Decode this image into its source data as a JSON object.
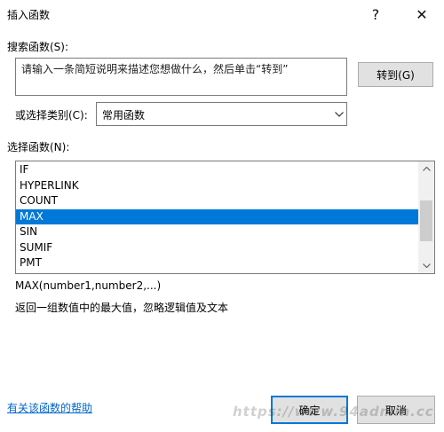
{
  "window": {
    "title": "插入函数",
    "help_glyph": "?",
    "close_glyph": "✕"
  },
  "search": {
    "label": "搜索函数(S):",
    "value": "请输入一条简短说明来描述您想做什么，然后单击“转到”",
    "goto_label": "转到(G)"
  },
  "category": {
    "label": "或选择类别(C):",
    "selected": "常用函数",
    "arrow_icon": "chevron-down-icon"
  },
  "functions": {
    "label": "选择函数(N):",
    "items": [
      "IF",
      "HYPERLINK",
      "COUNT",
      "MAX",
      "SIN",
      "SUMIF",
      "PMT"
    ],
    "selected_index": 3,
    "selected_color": "#0078d7"
  },
  "signature": "MAX(number1,number2,...)",
  "description": "返回一组数值中的最大值，忽略逻辑值及文本",
  "footer": {
    "help_link": "有关该函数的帮助",
    "ok_label": "确定",
    "cancel_label": "取消"
  },
  "watermark": "https://www.94admin.cc"
}
